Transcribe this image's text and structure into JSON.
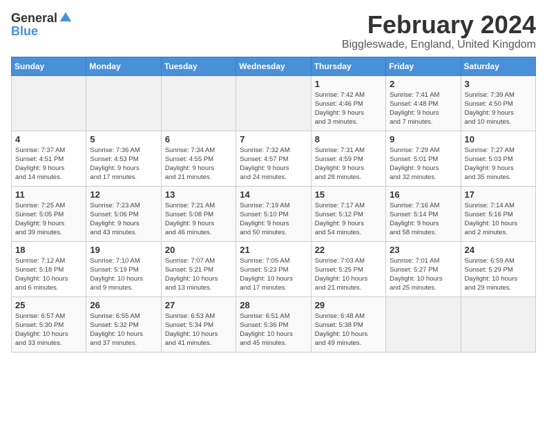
{
  "logo": {
    "general": "General",
    "blue": "Blue"
  },
  "title": "February 2024",
  "subtitle": "Biggleswade, England, United Kingdom",
  "days_of_week": [
    "Sunday",
    "Monday",
    "Tuesday",
    "Wednesday",
    "Thursday",
    "Friday",
    "Saturday"
  ],
  "weeks": [
    [
      {
        "day": "",
        "info": ""
      },
      {
        "day": "",
        "info": ""
      },
      {
        "day": "",
        "info": ""
      },
      {
        "day": "",
        "info": ""
      },
      {
        "day": "1",
        "info": "Sunrise: 7:42 AM\nSunset: 4:46 PM\nDaylight: 9 hours\nand 3 minutes."
      },
      {
        "day": "2",
        "info": "Sunrise: 7:41 AM\nSunset: 4:48 PM\nDaylight: 9 hours\nand 7 minutes."
      },
      {
        "day": "3",
        "info": "Sunrise: 7:39 AM\nSunset: 4:50 PM\nDaylight: 9 hours\nand 10 minutes."
      }
    ],
    [
      {
        "day": "4",
        "info": "Sunrise: 7:37 AM\nSunset: 4:51 PM\nDaylight: 9 hours\nand 14 minutes."
      },
      {
        "day": "5",
        "info": "Sunrise: 7:36 AM\nSunset: 4:53 PM\nDaylight: 9 hours\nand 17 minutes."
      },
      {
        "day": "6",
        "info": "Sunrise: 7:34 AM\nSunset: 4:55 PM\nDaylight: 9 hours\nand 21 minutes."
      },
      {
        "day": "7",
        "info": "Sunrise: 7:32 AM\nSunset: 4:57 PM\nDaylight: 9 hours\nand 24 minutes."
      },
      {
        "day": "8",
        "info": "Sunrise: 7:31 AM\nSunset: 4:59 PM\nDaylight: 9 hours\nand 28 minutes."
      },
      {
        "day": "9",
        "info": "Sunrise: 7:29 AM\nSunset: 5:01 PM\nDaylight: 9 hours\nand 32 minutes."
      },
      {
        "day": "10",
        "info": "Sunrise: 7:27 AM\nSunset: 5:03 PM\nDaylight: 9 hours\nand 35 minutes."
      }
    ],
    [
      {
        "day": "11",
        "info": "Sunrise: 7:25 AM\nSunset: 5:05 PM\nDaylight: 9 hours\nand 39 minutes."
      },
      {
        "day": "12",
        "info": "Sunrise: 7:23 AM\nSunset: 5:06 PM\nDaylight: 9 hours\nand 43 minutes."
      },
      {
        "day": "13",
        "info": "Sunrise: 7:21 AM\nSunset: 5:08 PM\nDaylight: 9 hours\nand 46 minutes."
      },
      {
        "day": "14",
        "info": "Sunrise: 7:19 AM\nSunset: 5:10 PM\nDaylight: 9 hours\nand 50 minutes."
      },
      {
        "day": "15",
        "info": "Sunrise: 7:17 AM\nSunset: 5:12 PM\nDaylight: 9 hours\nand 54 minutes."
      },
      {
        "day": "16",
        "info": "Sunrise: 7:16 AM\nSunset: 5:14 PM\nDaylight: 9 hours\nand 58 minutes."
      },
      {
        "day": "17",
        "info": "Sunrise: 7:14 AM\nSunset: 5:16 PM\nDaylight: 10 hours\nand 2 minutes."
      }
    ],
    [
      {
        "day": "18",
        "info": "Sunrise: 7:12 AM\nSunset: 5:18 PM\nDaylight: 10 hours\nand 6 minutes."
      },
      {
        "day": "19",
        "info": "Sunrise: 7:10 AM\nSunset: 5:19 PM\nDaylight: 10 hours\nand 9 minutes."
      },
      {
        "day": "20",
        "info": "Sunrise: 7:07 AM\nSunset: 5:21 PM\nDaylight: 10 hours\nand 13 minutes."
      },
      {
        "day": "21",
        "info": "Sunrise: 7:05 AM\nSunset: 5:23 PM\nDaylight: 10 hours\nand 17 minutes."
      },
      {
        "day": "22",
        "info": "Sunrise: 7:03 AM\nSunset: 5:25 PM\nDaylight: 10 hours\nand 21 minutes."
      },
      {
        "day": "23",
        "info": "Sunrise: 7:01 AM\nSunset: 5:27 PM\nDaylight: 10 hours\nand 25 minutes."
      },
      {
        "day": "24",
        "info": "Sunrise: 6:59 AM\nSunset: 5:29 PM\nDaylight: 10 hours\nand 29 minutes."
      }
    ],
    [
      {
        "day": "25",
        "info": "Sunrise: 6:57 AM\nSunset: 5:30 PM\nDaylight: 10 hours\nand 33 minutes."
      },
      {
        "day": "26",
        "info": "Sunrise: 6:55 AM\nSunset: 5:32 PM\nDaylight: 10 hours\nand 37 minutes."
      },
      {
        "day": "27",
        "info": "Sunrise: 6:53 AM\nSunset: 5:34 PM\nDaylight: 10 hours\nand 41 minutes."
      },
      {
        "day": "28",
        "info": "Sunrise: 6:51 AM\nSunset: 5:36 PM\nDaylight: 10 hours\nand 45 minutes."
      },
      {
        "day": "29",
        "info": "Sunrise: 6:48 AM\nSunset: 5:38 PM\nDaylight: 10 hours\nand 49 minutes."
      },
      {
        "day": "",
        "info": ""
      },
      {
        "day": "",
        "info": ""
      }
    ]
  ]
}
